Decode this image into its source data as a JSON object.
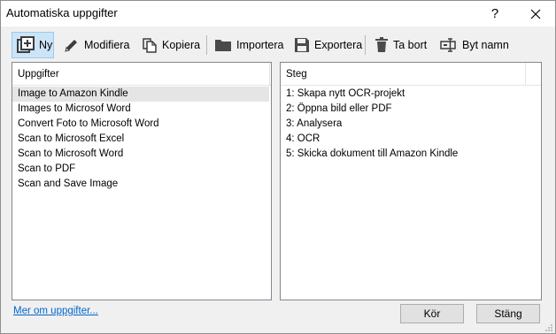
{
  "window": {
    "title": "Automatiska uppgifter",
    "help_label": "?"
  },
  "toolbar": {
    "new_label": "Ny",
    "modify_label": "Modifiera",
    "copy_label": "Kopiera",
    "import_label": "Importera",
    "export_label": "Exportera",
    "delete_label": "Ta bort",
    "rename_label": "Byt namn"
  },
  "tasks": {
    "header": "Uppgifter",
    "selected_index": 0,
    "items": [
      "Image to Amazon Kindle",
      "Images to Microsof Word",
      "Convert Foto to Microsoft Word",
      "Scan to Microsoft Excel",
      "Scan to Microsoft Word",
      "Scan to PDF",
      "Scan and Save Image"
    ]
  },
  "steps": {
    "header": "Steg",
    "items": [
      "1: Skapa nytt OCR-projekt",
      "2: Öppna bild eller PDF",
      "3: Analysera",
      "4: OCR",
      "5: Skicka dokument till Amazon Kindle"
    ]
  },
  "footer": {
    "link_label": "Mer om uppgifter...",
    "run_label": "Kör",
    "close_label": "Stäng"
  },
  "colors": {
    "accent_selected_bg": "#cce4f7",
    "link": "#0066cc",
    "icon_dark": "#3c3c3c"
  }
}
